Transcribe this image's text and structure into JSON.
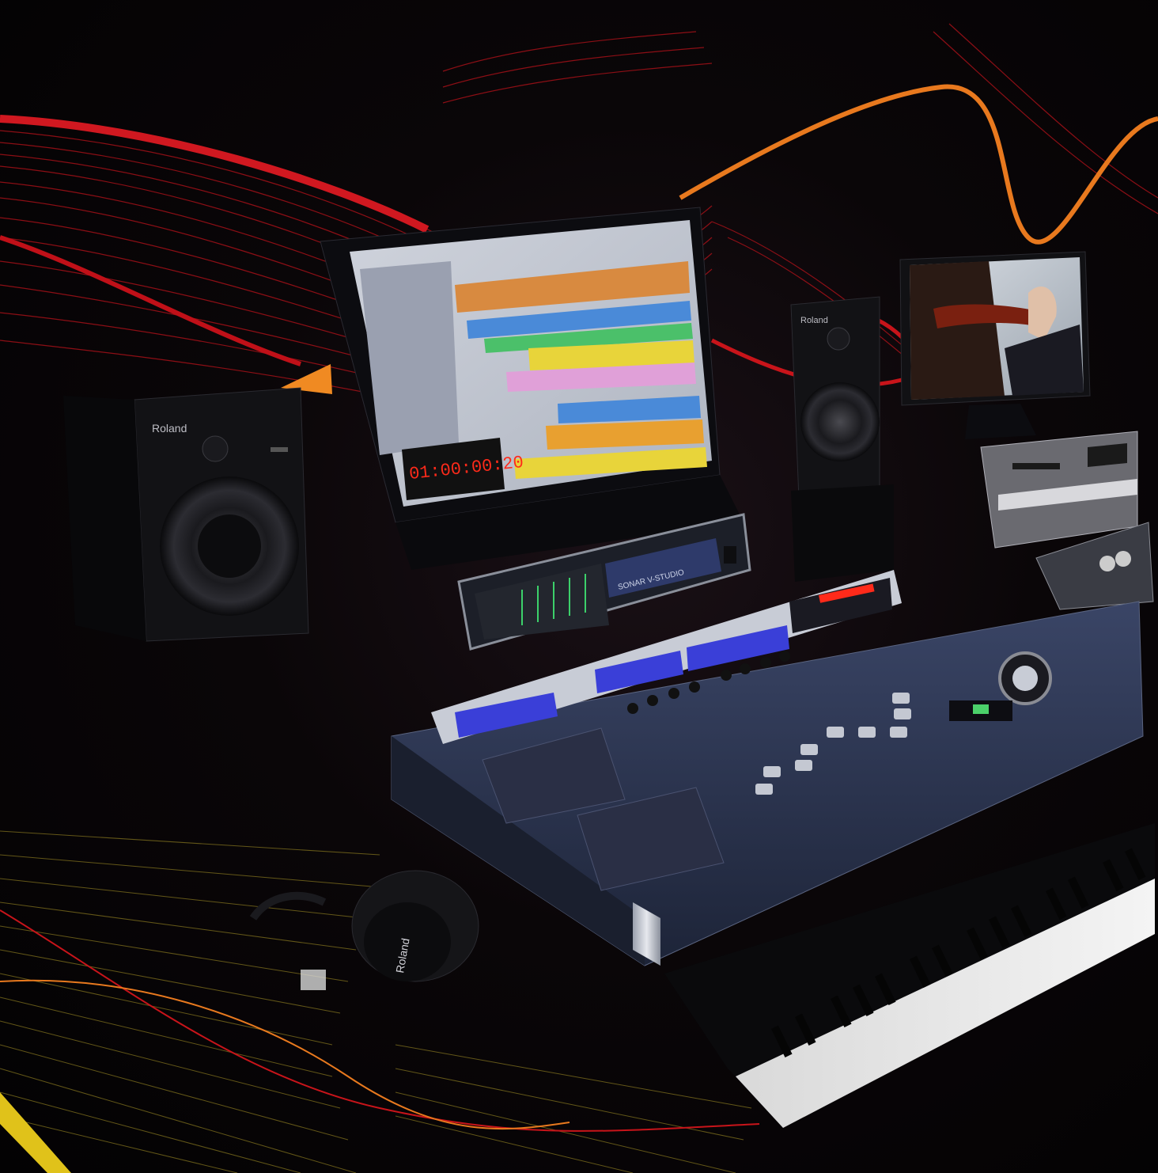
{
  "scene": {
    "brand_left_speaker": "Roland",
    "brand_right_speaker": "Roland",
    "brand_headphones": "Roland",
    "interface_name": "SONAR V-STUDIO",
    "monitor_timecode": "01:00:00:20",
    "colors": {
      "ribbon_red": "#c8141a",
      "ribbon_orange": "#e8791e",
      "console_blue": "#2b3552",
      "lcd_blue": "#3a3fd8",
      "led_red": "#ff2a1a"
    },
    "icons": [
      "speaker-left-icon",
      "speaker-right-icon",
      "monitor-icon",
      "video-monitor-icon",
      "console-icon",
      "keyboard-icon",
      "headphones-icon",
      "audio-interface-icon",
      "video-deck-icon"
    ]
  }
}
